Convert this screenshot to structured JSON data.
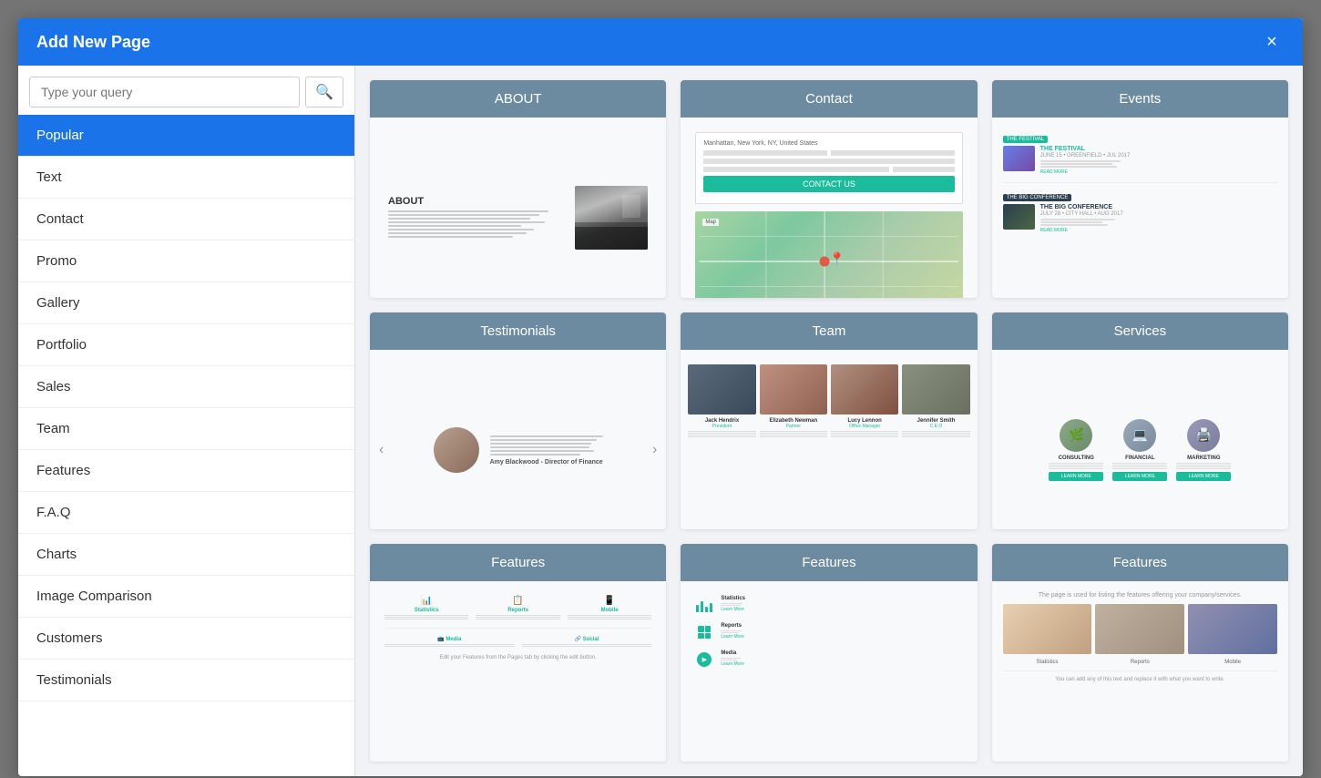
{
  "modal": {
    "title": "Add New Page",
    "close_label": "×"
  },
  "search": {
    "placeholder": "Type your query",
    "button_icon": "🔍"
  },
  "sidebar": {
    "items": [
      {
        "label": "Popular",
        "active": true
      },
      {
        "label": "Text",
        "active": false
      },
      {
        "label": "Contact",
        "active": false
      },
      {
        "label": "Promo",
        "active": false
      },
      {
        "label": "Gallery",
        "active": false
      },
      {
        "label": "Portfolio",
        "active": false
      },
      {
        "label": "Sales",
        "active": false
      },
      {
        "label": "Team",
        "active": false
      },
      {
        "label": "Features",
        "active": false
      },
      {
        "label": "F.A.Q",
        "active": false
      },
      {
        "label": "Charts",
        "active": false
      },
      {
        "label": "Image Comparison",
        "active": false
      },
      {
        "label": "Customers",
        "active": false
      },
      {
        "label": "Testimonials",
        "active": false
      }
    ]
  },
  "cards": [
    {
      "title": "ABOUT"
    },
    {
      "title": "Contact"
    },
    {
      "title": "Events"
    },
    {
      "title": "Testimonials"
    },
    {
      "title": "Team"
    },
    {
      "title": "Services"
    },
    {
      "title": "Features"
    },
    {
      "title": "Features"
    },
    {
      "title": "Features"
    }
  ],
  "colors": {
    "primary": "#1a73e8",
    "accent": "#1abc9c",
    "card_header_bg": "#6c8ba0",
    "active_sidebar": "#1a73e8"
  }
}
